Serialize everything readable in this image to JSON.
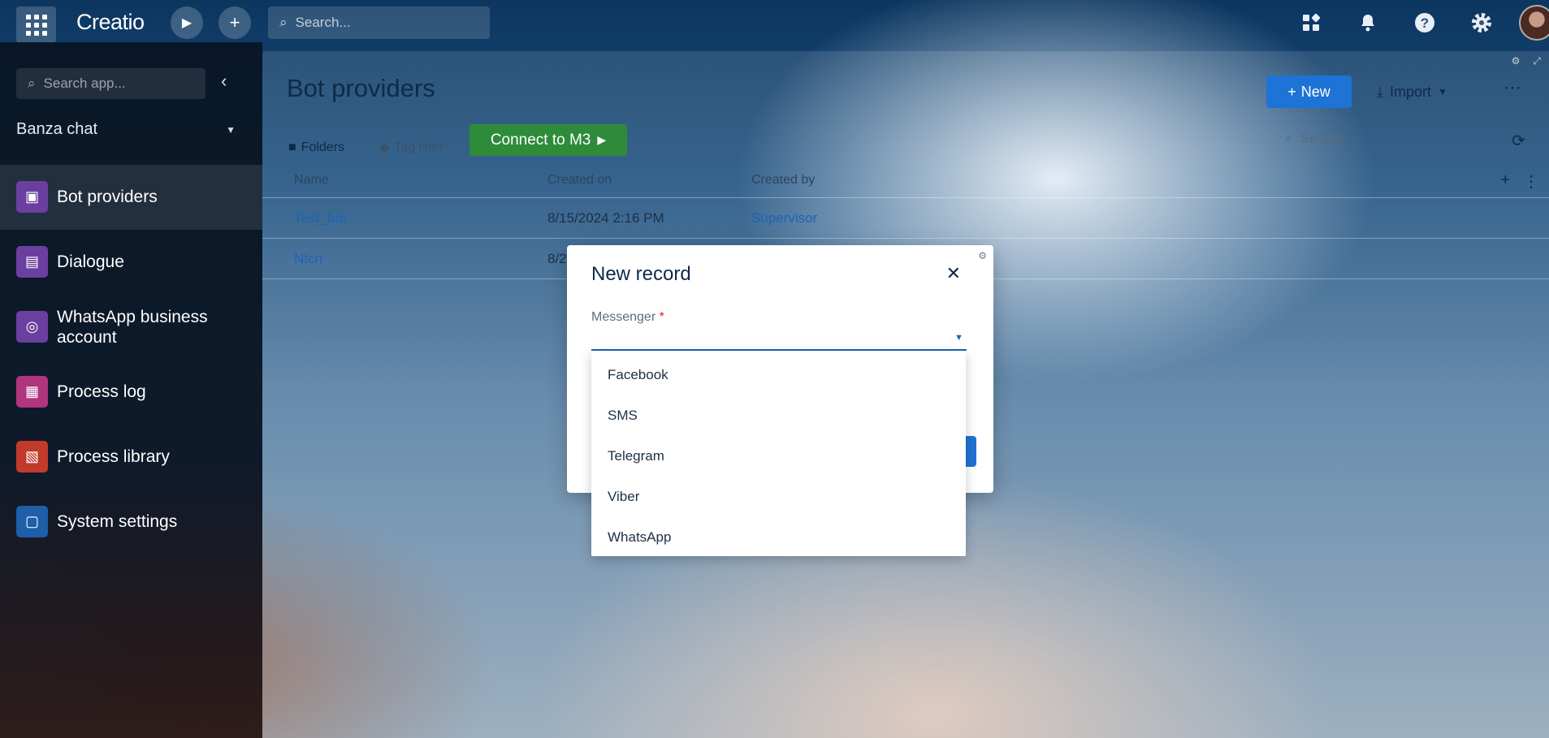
{
  "topbar": {
    "logo": "Creatio",
    "search_placeholder": "Search..."
  },
  "sidebar": {
    "search_placeholder": "Search app...",
    "workspace": "Banza chat",
    "items": [
      {
        "label": "Bot providers",
        "color": "#6b3fa0"
      },
      {
        "label": "Dialogue",
        "color": "#6b3fa0"
      },
      {
        "label": "WhatsApp business account",
        "color": "#6b3fa0"
      },
      {
        "label": "Process log",
        "color": "#b0357c"
      },
      {
        "label": "Process library",
        "color": "#c23a2c"
      },
      {
        "label": "System settings",
        "color": "#1d5fa8"
      }
    ]
  },
  "main": {
    "title": "Bot providers",
    "new_label": "New",
    "import_label": "Import",
    "folders_label": "Folders",
    "tag_filter_label": "Tag filter",
    "connect_label": "Connect to M3",
    "search_placeholder": "Search",
    "columns": [
      "Name",
      "Created on",
      "Created by"
    ],
    "rows": [
      {
        "name": "Test_bot",
        "created_on": "8/15/2024 2:16 PM",
        "created_by": "Supervisor"
      },
      {
        "name": "Ntcn",
        "created_on": "8/2",
        "created_by": ""
      }
    ]
  },
  "modal": {
    "title": "New record",
    "field_label": "Messenger",
    "required_mark": "*",
    "options": [
      "Facebook",
      "SMS",
      "Telegram",
      "Viber",
      "WhatsApp"
    ]
  },
  "colors": {
    "primary": "#1e73d6",
    "success": "#2e8b3a"
  }
}
